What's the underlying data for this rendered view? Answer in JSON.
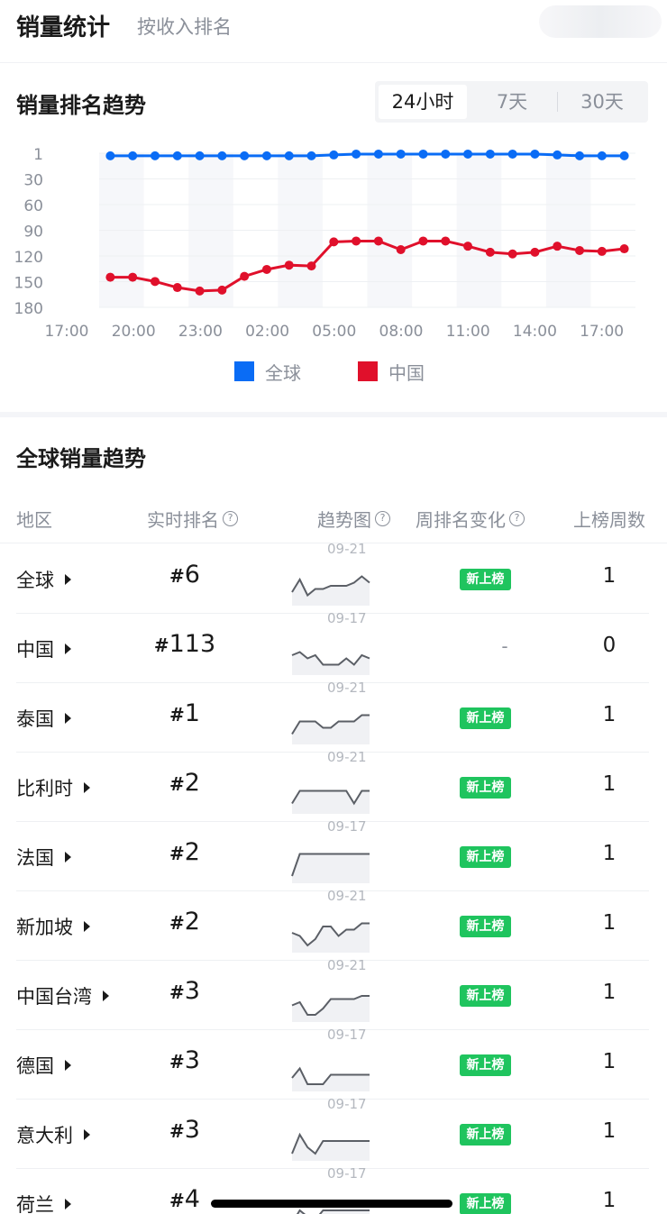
{
  "header": {
    "title": "销量统计",
    "subtitle": "按收入排名"
  },
  "rank_trend": {
    "title": "销量排名趋势",
    "ranges": [
      "24小时",
      "7天",
      "30天"
    ],
    "selected_range": "24小时",
    "legend": [
      {
        "name": "全球",
        "color": "#0a6cf5"
      },
      {
        "name": "中国",
        "color": "#e0102b"
      }
    ]
  },
  "chart_data": {
    "type": "line",
    "y_ticks": [
      1,
      30,
      60,
      90,
      120,
      150,
      180
    ],
    "ylim": [
      180,
      1
    ],
    "y_inverted": true,
    "x_ticks": [
      "17:00",
      "20:00",
      "23:00",
      "02:00",
      "05:00",
      "08:00",
      "11:00",
      "14:00",
      "17:00"
    ],
    "grid": "alternating vertical bands",
    "legend_position": "bottom-center",
    "series": [
      {
        "name": "全球",
        "color": "#0a6cf5",
        "values": [
          4,
          4,
          4,
          4,
          4,
          4,
          4,
          4,
          4,
          4,
          3,
          2,
          2,
          2,
          2,
          2,
          2,
          2,
          2,
          2,
          3,
          4,
          4,
          4
        ]
      },
      {
        "name": "中国",
        "color": "#e0102b",
        "values": [
          145,
          145,
          150,
          157,
          161,
          160,
          144,
          136,
          131,
          132,
          104,
          103,
          103,
          113,
          103,
          103,
          109,
          116,
          118,
          116,
          109,
          114,
          115,
          112
        ]
      }
    ]
  },
  "global_trend": {
    "title": "全球销量趋势",
    "headers": {
      "region": "地区",
      "rank": "实时排名",
      "trend": "趋势图",
      "weekly_change": "周排名变化",
      "weeks": "上榜周数"
    },
    "rank_prefix": "#",
    "rows": [
      {
        "region": "全球",
        "rank": "6",
        "date": "09-21",
        "change": "新上榜",
        "weeks": "1",
        "spark": [
          6,
          2,
          7,
          5,
          5,
          4,
          4,
          4,
          3,
          1,
          3
        ]
      },
      {
        "region": "中国",
        "rank": "113",
        "date": "09-17",
        "change": "-",
        "weeks": "0",
        "spark": [
          4,
          3,
          5,
          4,
          7,
          7,
          7,
          5,
          7,
          4,
          5
        ]
      },
      {
        "region": "泰国",
        "rank": "1",
        "date": "09-21",
        "change": "新上榜",
        "weeks": "1",
        "spark": [
          7,
          3,
          3,
          3,
          5,
          5,
          3,
          3,
          3,
          1,
          1
        ]
      },
      {
        "region": "比利时",
        "rank": "2",
        "date": "09-21",
        "change": "新上榜",
        "weeks": "1",
        "spark": [
          7,
          3,
          3,
          3,
          3,
          3,
          3,
          3,
          7,
          3,
          3
        ]
      },
      {
        "region": "法国",
        "rank": "2",
        "date": "09-17",
        "change": "新上榜",
        "weeks": "1",
        "spark": [
          8,
          1,
          1,
          1,
          1,
          1,
          1,
          1,
          1,
          1,
          1
        ]
      },
      {
        "region": "新加坡",
        "rank": "2",
        "date": "09-21",
        "change": "新上榜",
        "weeks": "1",
        "spark": [
          4,
          5,
          8,
          6,
          2,
          2,
          5,
          3,
          3,
          1,
          1
        ]
      },
      {
        "region": "中国台湾",
        "rank": "3",
        "date": "09-21",
        "change": "新上榜",
        "weeks": "1",
        "spark": [
          5,
          4,
          8,
          8,
          6,
          3,
          3,
          3,
          3,
          2,
          2
        ]
      },
      {
        "region": "德国",
        "rank": "3",
        "date": "09-17",
        "change": "新上榜",
        "weeks": "1",
        "spark": [
          6,
          3,
          8,
          8,
          8,
          5,
          5,
          5,
          5,
          5,
          5
        ]
      },
      {
        "region": "意大利",
        "rank": "3",
        "date": "09-17",
        "change": "新上榜",
        "weeks": "1",
        "spark": [
          8,
          2,
          6,
          8,
          4,
          4,
          4,
          4,
          4,
          4,
          4
        ]
      },
      {
        "region": "荷兰",
        "rank": "4",
        "date": "09-17",
        "change": "新上榜",
        "weeks": "1",
        "spark": [
          8,
          4,
          6,
          7,
          4,
          4,
          4,
          4,
          4,
          4,
          4
        ]
      }
    ]
  }
}
